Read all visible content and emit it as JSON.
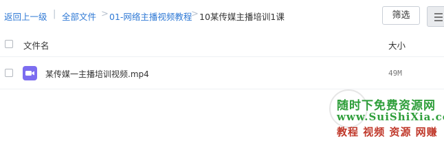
{
  "breadcrumb": {
    "back": "返回上一级",
    "items": [
      "全部文件",
      "01-网络主播视频教程",
      "10某传媒主播培训1课"
    ]
  },
  "toolbar": {
    "filter_label": "筛选",
    "view_icon": "list-view-icon"
  },
  "table": {
    "columns": {
      "name": "文件名",
      "size": "大小"
    },
    "rows": [
      {
        "name": "某传媒一主播培训视频.mp4",
        "size": "49M",
        "icon": "video-file-icon",
        "icon_color": "#7c6df0"
      }
    ]
  },
  "watermark": {
    "line1": "随时下免费资源网",
    "line2": "www.SuiShiXia.com",
    "line3": "教程 视频 资源 网赚"
  },
  "colors": {
    "link": "#2f79d5",
    "watermark_green": "#2e9e3a",
    "watermark_red": "#c0392b"
  }
}
